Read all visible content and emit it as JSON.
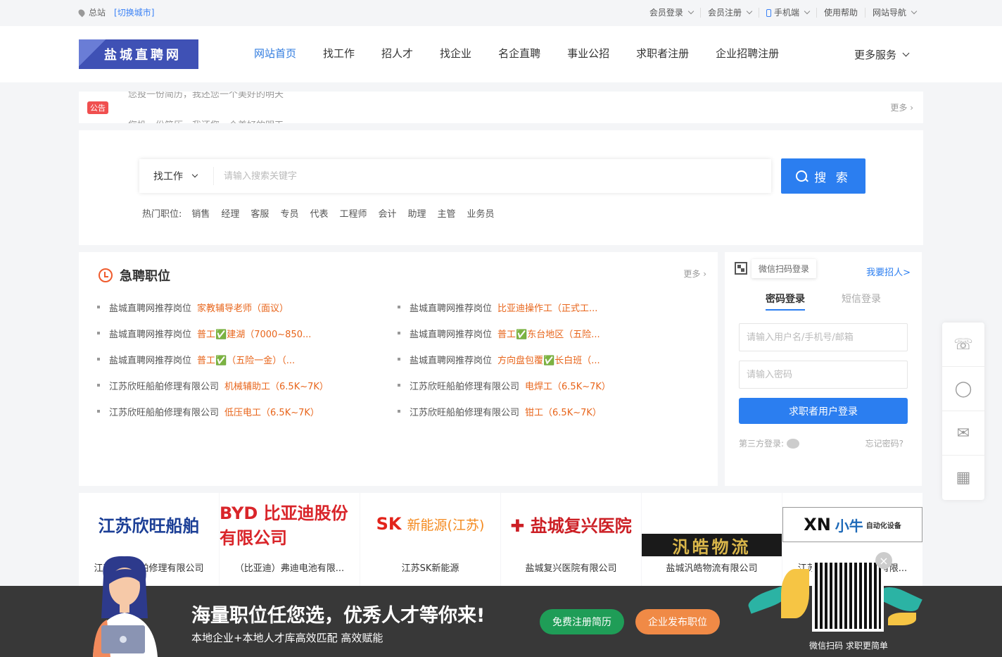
{
  "topbar": {
    "site": "总站",
    "switch_city": "[切换城市]",
    "links": [
      "会员登录",
      "会员注册",
      "手机端",
      "使用帮助",
      "网站导航"
    ]
  },
  "header": {
    "logo": "盐城直聘网",
    "nav": [
      "网站首页",
      "找工作",
      "招人才",
      "找企业",
      "名企直聘",
      "事业公招",
      "求职者注册",
      "企业招聘注册"
    ],
    "more": "更多服务"
  },
  "notice": {
    "badge": "公告",
    "line1": "您投一份简历，我还您一个美好的明天",
    "line2": "您投一份简历，我还您一个美好的明天",
    "more": "更多"
  },
  "search": {
    "type": "找工作",
    "placeholder": "请输入搜索关键字",
    "button": "搜 索",
    "hot_label": "热门职位:",
    "hot": [
      "销售",
      "经理",
      "客服",
      "专员",
      "代表",
      "工程师",
      "会计",
      "助理",
      "主管",
      "业务员"
    ]
  },
  "jobs": {
    "title": "急聘职位",
    "more": "更多",
    "items": [
      {
        "company": "盐城直聘网推荐岗位",
        "position": "家教辅导老师（面议）"
      },
      {
        "company": "盐城直聘网推荐岗位",
        "position": "比亚迪操作工（正式工..."
      },
      {
        "company": "盐城直聘网推荐岗位",
        "position": "普工✅建湖（7000~850..."
      },
      {
        "company": "盐城直聘网推荐岗位",
        "position": "普工✅东台地区（五险..."
      },
      {
        "company": "盐城直聘网推荐岗位",
        "position": "普工✅（五险一金）（..."
      },
      {
        "company": "盐城直聘网推荐岗位",
        "position": "方向盘包覆✅长白班（..."
      },
      {
        "company": "江苏欣旺船舶修理有限公司",
        "position": "机械辅助工（6.5K~7K）"
      },
      {
        "company": "江苏欣旺船舶修理有限公司",
        "position": "电焊工（6.5K~7K）"
      },
      {
        "company": "江苏欣旺船舶修理有限公司",
        "position": "低压电工（6.5K~7K）"
      },
      {
        "company": "江苏欣旺船舶修理有限公司",
        "position": "钳工（6.5K~7K）"
      }
    ]
  },
  "login": {
    "qr_tip": "微信扫码登录",
    "want_hire": "我要招人>",
    "tab_password": "密码登录",
    "tab_sms": "短信登录",
    "username_placeholder": "请输入用户名/手机号/邮箱",
    "password_placeholder": "请输入密码",
    "button": "求职者用户登录",
    "third_party": "第三方登录:",
    "forgot": "忘记密码?"
  },
  "companies": [
    {
      "logo": "江苏欣旺船舶",
      "name": "江苏欣旺船舶修理有限公司"
    },
    {
      "logo": "BYD 比亚迪股份有限公司",
      "name": "（比亚迪）弗迪电池有限..."
    },
    {
      "logo": "SK",
      "logo_sub": "新能源(江苏)",
      "name": "江苏SK新能源"
    },
    {
      "logo": "✚ 盐城复兴医院",
      "name": "盐城复兴医院有限公司"
    },
    {
      "logo": "汎皓物流",
      "name": "盐城汎皓物流有限公司"
    },
    {
      "logo": "XN",
      "logo_cn": "小牛",
      "logo_sm": "自动化设备",
      "name": "江苏小牛自动化设备有限..."
    }
  ],
  "banner": {
    "headline": "海量职位任您选，优秀人才等你来!",
    "sub": "本地企业+本地人才库高效匹配 高效赋能",
    "btn_resume": "免费注册简历",
    "btn_post": "企业发布职位",
    "qr_caption": "微信扫码 求职更简单"
  }
}
